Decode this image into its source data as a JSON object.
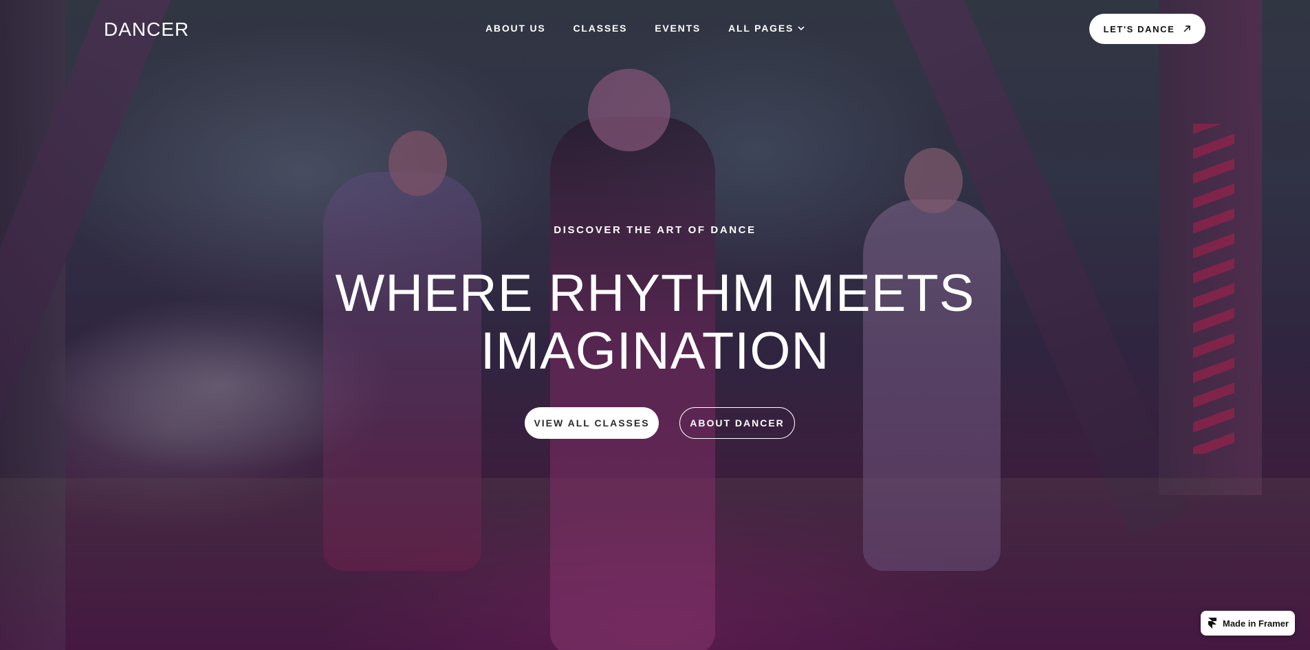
{
  "header": {
    "logo": "DANCER",
    "nav": [
      {
        "label": "ABOUT US"
      },
      {
        "label": "CLASSES"
      },
      {
        "label": "EVENTS"
      },
      {
        "label": "ALL PAGES",
        "icon": "chevron-down-icon"
      }
    ],
    "cta_label": "LET'S DANCE",
    "cta_icon": "arrow-up-right-icon"
  },
  "hero": {
    "eyebrow": "DISCOVER THE ART OF DANCE",
    "headline_line1": "WHERE RHYTHM MEETS",
    "headline_line2": "IMAGINATION",
    "primary_button": "VIEW ALL CLASSES",
    "secondary_button": "ABOUT DANCER"
  },
  "badge": {
    "label": "Made in Framer",
    "icon": "framer-logo-icon"
  },
  "colors": {
    "text": "#ffffff",
    "button_bg": "#ffffff",
    "button_text": "#2a2a2a",
    "tint": "#a0287a"
  }
}
